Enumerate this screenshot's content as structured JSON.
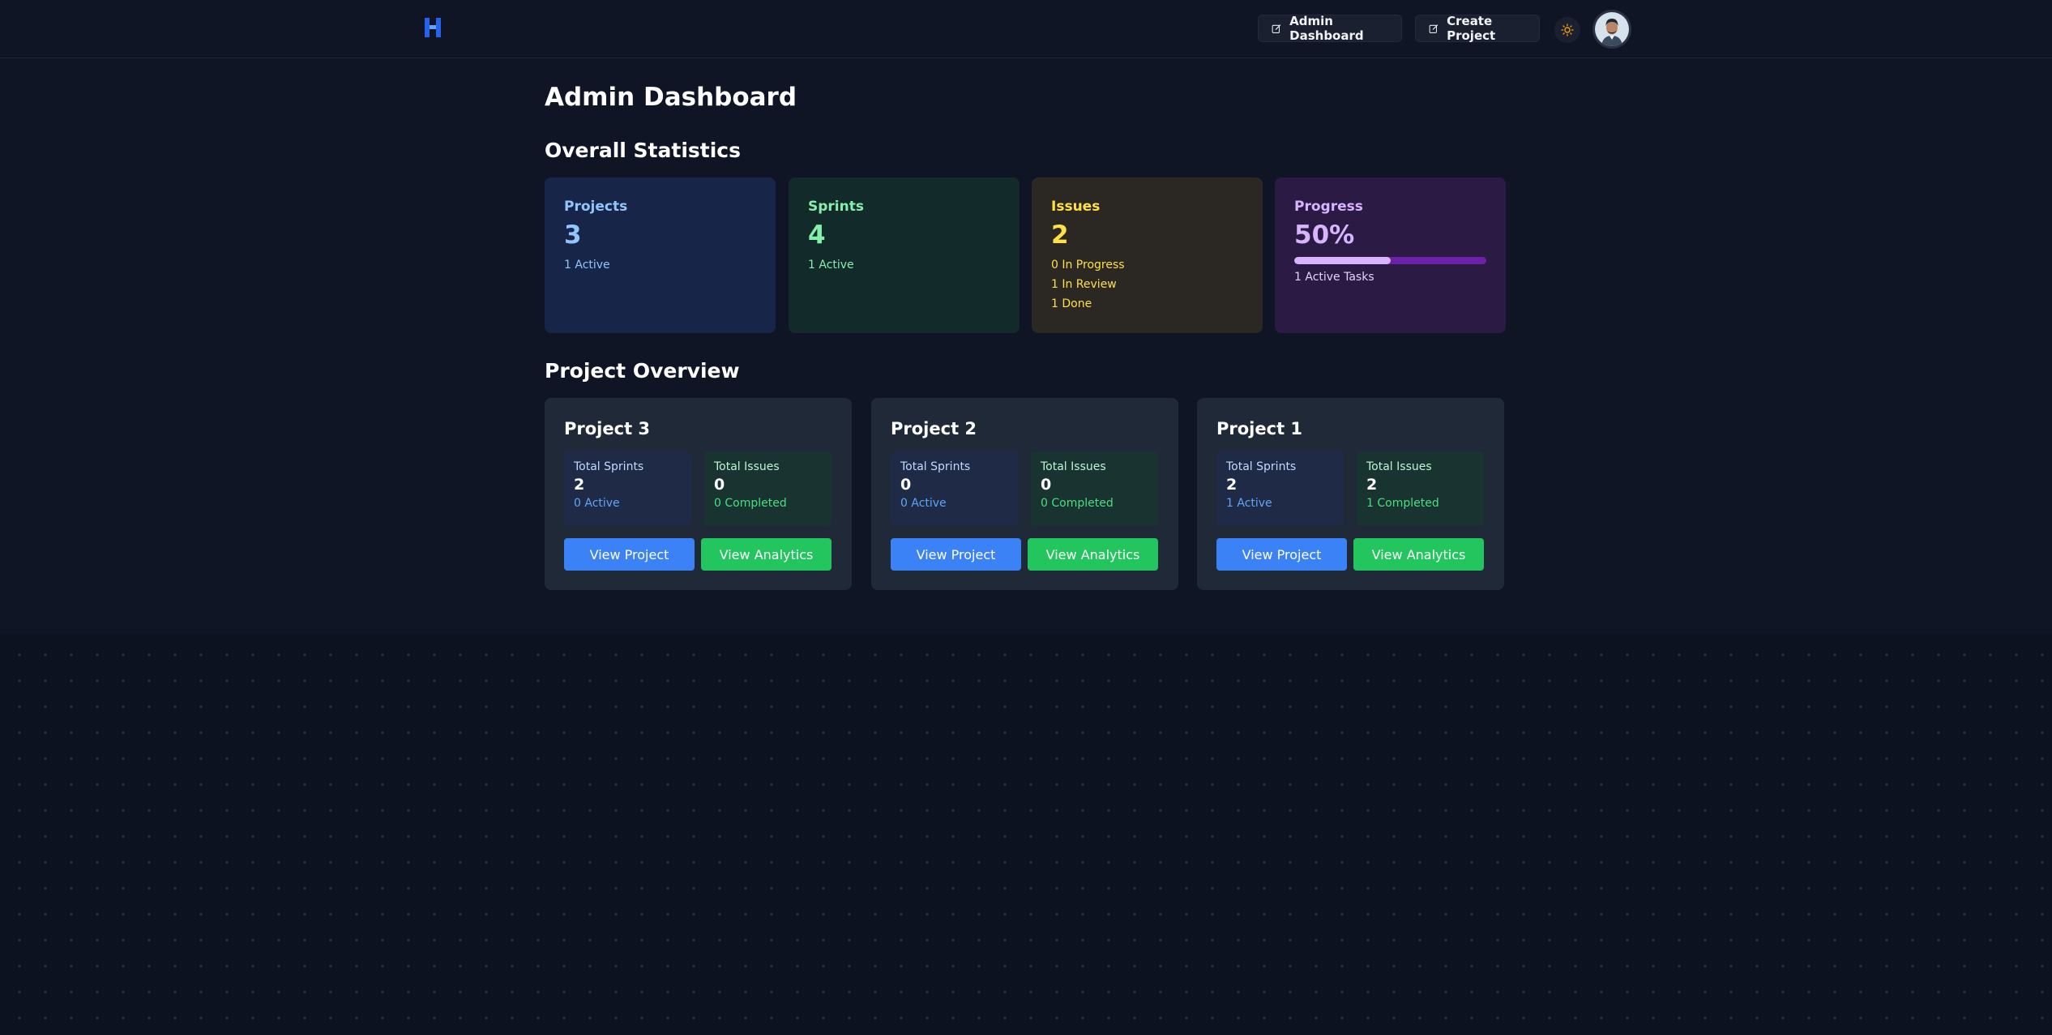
{
  "header": {
    "logo_icon": "h-logo-icon",
    "admin_dashboard_label": "Admin Dashboard",
    "create_project_label": "Create Project",
    "theme_icon": "sun-icon",
    "avatar_icon": "user-avatar"
  },
  "page": {
    "title": "Admin Dashboard",
    "stats_heading": "Overall Statistics",
    "overview_heading": "Project Overview"
  },
  "stats": {
    "projects": {
      "label": "Projects",
      "value": "3",
      "sub": "1 Active"
    },
    "sprints": {
      "label": "Sprints",
      "value": "4",
      "sub": "1 Active"
    },
    "issues": {
      "label": "Issues",
      "value": "2",
      "subs": [
        "0 In Progress",
        "1 In Review",
        "1 Done"
      ]
    },
    "progress": {
      "label": "Progress",
      "value": "50%",
      "fraction": 0.5,
      "sub": "1 Active Tasks"
    }
  },
  "projects": [
    {
      "name": "Project 3",
      "sprints_label": "Total Sprints",
      "sprints_value": "2",
      "sprints_sub": "0 Active",
      "issues_label": "Total Issues",
      "issues_value": "0",
      "issues_sub": "0 Completed",
      "view_label": "View Project",
      "analytics_label": "View Analytics"
    },
    {
      "name": "Project 2",
      "sprints_label": "Total Sprints",
      "sprints_value": "0",
      "sprints_sub": "0 Active",
      "issues_label": "Total Issues",
      "issues_value": "0",
      "issues_sub": "0 Completed",
      "view_label": "View Project",
      "analytics_label": "View Analytics"
    },
    {
      "name": "Project 1",
      "sprints_label": "Total Sprints",
      "sprints_value": "2",
      "sprints_sub": "1 Active",
      "issues_label": "Total Issues",
      "issues_value": "2",
      "issues_sub": "1 Completed",
      "view_label": "View Project",
      "analytics_label": "View Analytics"
    }
  ],
  "colors": {
    "background": "#0f1524",
    "blue_accent": "#3b82f6",
    "green_accent": "#22c55e",
    "projects_card": "#172548",
    "sprints_card": "#122a2a",
    "issues_card": "#2b2723",
    "progress_card": "#2a1a44"
  }
}
